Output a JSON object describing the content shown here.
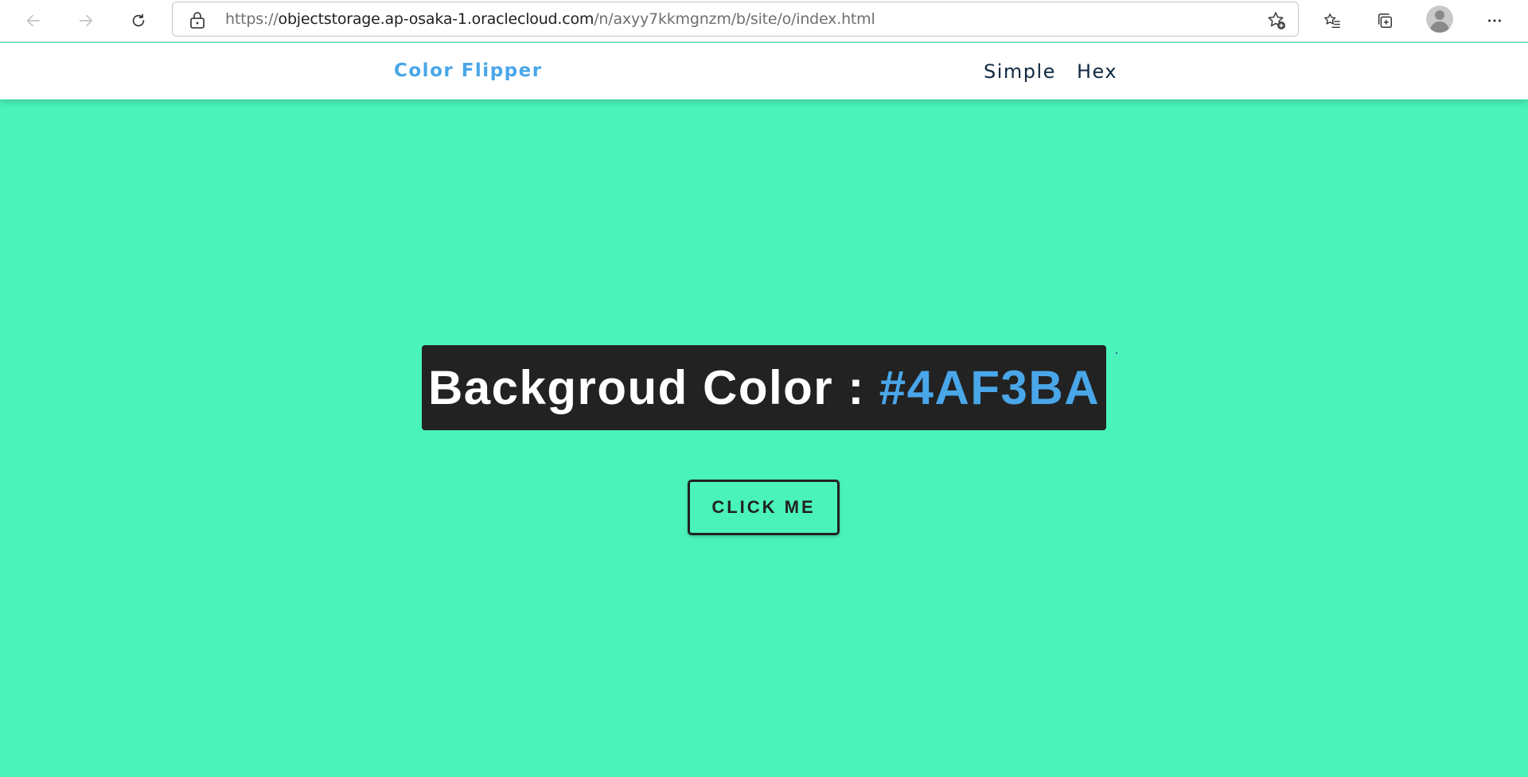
{
  "browser": {
    "url_prefix": "https://",
    "url_domain": "objectstorage.ap-osaka-1.oraclecloud.com",
    "url_path": "/n/axyy7kkmgnzm/b/site/o/index.html",
    "icons": [
      "back-arrow-icon",
      "forward-arrow-icon",
      "refresh-icon",
      "lock-icon",
      "add-favorite-icon",
      "favorites-icon",
      "collections-icon",
      "profile-avatar-icon",
      "more-options-icon"
    ]
  },
  "navbar": {
    "brand": "Color Flipper",
    "links": [
      "Simple",
      "Hex"
    ]
  },
  "main": {
    "label": "Backgroud Color :",
    "color_value": "#4AF3BA",
    "button_label": "CLICK ME"
  },
  "colors": {
    "background": "#4AF3BA",
    "brand": "#49A6E9",
    "banner": "#222222",
    "nav_text": "#102A42"
  }
}
